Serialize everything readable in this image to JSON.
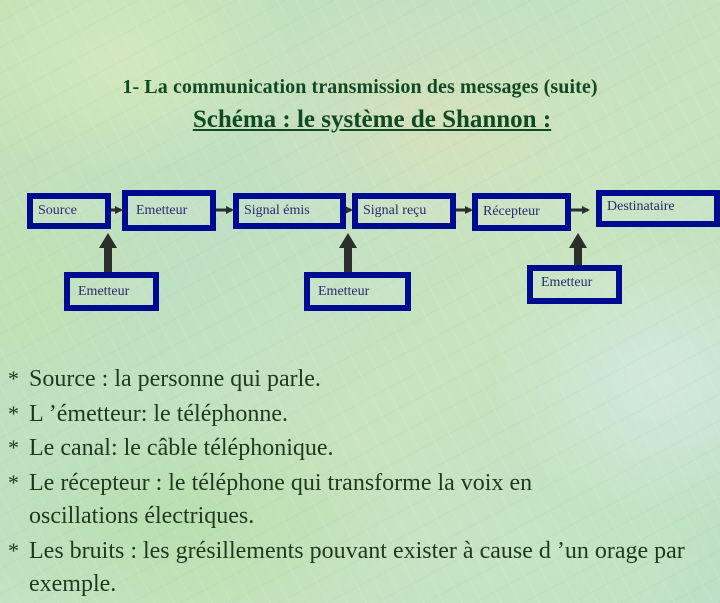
{
  "slide": {
    "title": "1- La communication transmission des messages (suite)",
    "subtitle": "Schéma : le système de Shannon :",
    "colors": {
      "title_text": "#0f4a22",
      "box_border": "#000c90",
      "box_text": "#2a2a6e",
      "arrow": "#2b2f2b",
      "body_text": "#1e3a1e"
    }
  },
  "diagram": {
    "chain": [
      {
        "id": "source",
        "label": "Source"
      },
      {
        "id": "emetteur",
        "label": "Emetteur"
      },
      {
        "id": "signal-emis",
        "label": "Signal émis"
      },
      {
        "id": "signal-recu",
        "label": "Signal reçu"
      },
      {
        "id": "recepteur",
        "label": "Récepteur"
      },
      {
        "id": "destinataire",
        "label": "Destinataire"
      }
    ],
    "inputs": [
      {
        "id": "input-1",
        "label": "Emetteur",
        "points_to": "between source and emetteur"
      },
      {
        "id": "input-2",
        "label": "Emetteur",
        "points_to": "between signal-emis and signal-recu"
      },
      {
        "id": "input-3",
        "label": "Emetteur",
        "points_to": "between recepteur and destinataire"
      }
    ]
  },
  "bullets": [
    {
      "marker": "*",
      "text": "Source : la personne qui parle."
    },
    {
      "marker": "*",
      "text": "L ’émetteur: le téléphonne."
    },
    {
      "marker": "*",
      "text": "Le canal: le câble téléphonique."
    },
    {
      "marker": "*",
      "text": "Le récepteur : le téléphone qui transforme la voix en oscillations électriques."
    },
    {
      "marker": "*",
      "text": "Les bruits : les grésillements pouvant exister à cause d ’un orage par exemple."
    }
  ]
}
